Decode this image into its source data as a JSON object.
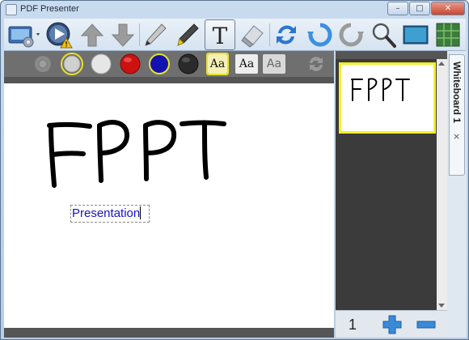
{
  "window": {
    "title": "PDF Presenter",
    "controls": {
      "minimize": "–",
      "maximize": "□",
      "close": "✕"
    }
  },
  "toolbar": {
    "items": [
      {
        "name": "screen-settings-icon"
      },
      {
        "name": "play-warning-icon"
      },
      {
        "name": "arrow-up-icon"
      },
      {
        "name": "arrow-down-icon"
      },
      {
        "name": "pen-icon"
      },
      {
        "name": "highlighter-icon"
      },
      {
        "name": "text-tool-icon",
        "glyph": "T",
        "active": true
      },
      {
        "name": "eraser-icon"
      },
      {
        "name": "sync-icon"
      },
      {
        "name": "undo-icon"
      },
      {
        "name": "redo-icon"
      },
      {
        "name": "zoom-icon"
      },
      {
        "name": "screen-icon"
      },
      {
        "name": "grid-icon"
      }
    ]
  },
  "subtoolbar": {
    "colors": [
      "#d0d0d0",
      "#e0e0e0",
      "#cc1111",
      "#1212b0",
      "#2a2a2a"
    ],
    "active_color_index": 0,
    "fonts": [
      "Aa",
      "Aa",
      "Aa"
    ]
  },
  "canvas": {
    "drawing_text": "FPPT",
    "textbox_value": "Presentation"
  },
  "panel": {
    "thumbnail_text": "FPPT",
    "page_number": "1",
    "tab_label": "Whiteboard 1",
    "tab_close": "×"
  },
  "colors": {
    "accent_yellow": "#f2ef2b",
    "text_blue": "#1414c8"
  }
}
